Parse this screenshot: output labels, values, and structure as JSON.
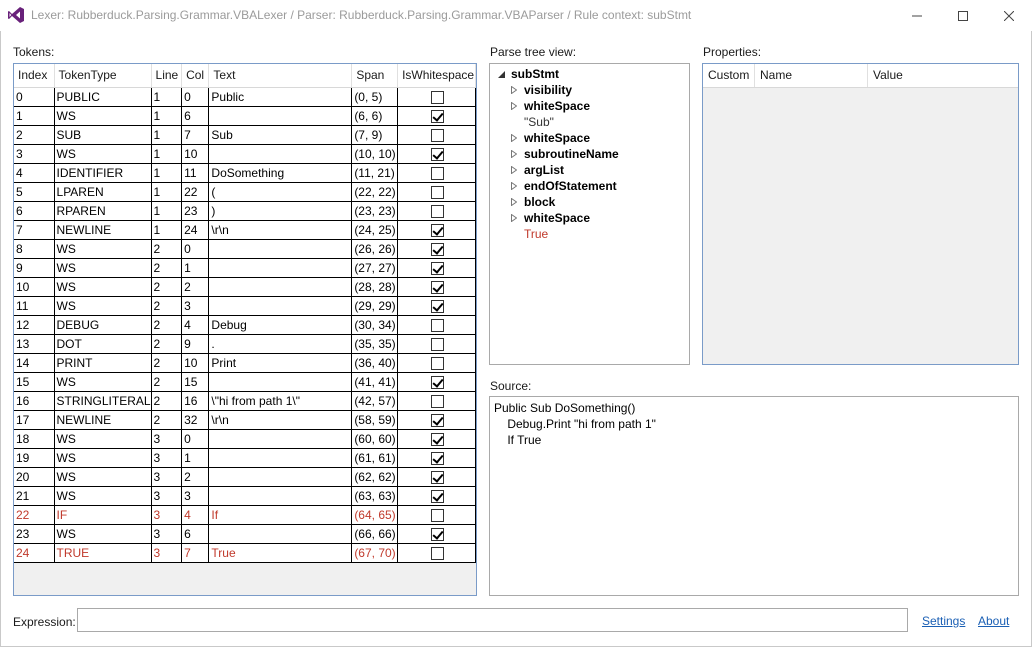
{
  "window": {
    "title": "Lexer: Rubberduck.Parsing.Grammar.VBALexer  /   Parser: Rubberduck.Parsing.Grammar.VBAParser  /   Rule context: subStmt",
    "min_glyph": "—",
    "max_glyph": "☐",
    "close_glyph": "✕"
  },
  "tokens": {
    "label": "Tokens:",
    "columns": [
      "Index",
      "TokenType",
      "Line",
      "Col",
      "Text",
      "Span",
      "IsWhitespace"
    ],
    "rows": [
      {
        "index": "0",
        "type": "PUBLIC",
        "line": "1",
        "col": "0",
        "text": "Public",
        "span": "(0, 5)",
        "ws": false,
        "hl": false
      },
      {
        "index": "1",
        "type": "WS",
        "line": "1",
        "col": "6",
        "text": "",
        "span": "(6, 6)",
        "ws": true,
        "hl": false
      },
      {
        "index": "2",
        "type": "SUB",
        "line": "1",
        "col": "7",
        "text": "Sub",
        "span": "(7, 9)",
        "ws": false,
        "hl": false
      },
      {
        "index": "3",
        "type": "WS",
        "line": "1",
        "col": "10",
        "text": "",
        "span": "(10, 10)",
        "ws": true,
        "hl": false
      },
      {
        "index": "4",
        "type": "IDENTIFIER",
        "line": "1",
        "col": "11",
        "text": "DoSomething",
        "span": "(11, 21)",
        "ws": false,
        "hl": false
      },
      {
        "index": "5",
        "type": "LPAREN",
        "line": "1",
        "col": "22",
        "text": "(",
        "span": "(22, 22)",
        "ws": false,
        "hl": false
      },
      {
        "index": "6",
        "type": "RPAREN",
        "line": "1",
        "col": "23",
        "text": ")",
        "span": "(23, 23)",
        "ws": false,
        "hl": false
      },
      {
        "index": "7",
        "type": "NEWLINE",
        "line": "1",
        "col": "24",
        "text": "\\r\\n",
        "span": "(24, 25)",
        "ws": true,
        "hl": false
      },
      {
        "index": "8",
        "type": "WS",
        "line": "2",
        "col": "0",
        "text": "",
        "span": "(26, 26)",
        "ws": true,
        "hl": false
      },
      {
        "index": "9",
        "type": "WS",
        "line": "2",
        "col": "1",
        "text": "",
        "span": "(27, 27)",
        "ws": true,
        "hl": false
      },
      {
        "index": "10",
        "type": "WS",
        "line": "2",
        "col": "2",
        "text": "",
        "span": "(28, 28)",
        "ws": true,
        "hl": false
      },
      {
        "index": "11",
        "type": "WS",
        "line": "2",
        "col": "3",
        "text": "",
        "span": "(29, 29)",
        "ws": true,
        "hl": false
      },
      {
        "index": "12",
        "type": "DEBUG",
        "line": "2",
        "col": "4",
        "text": "Debug",
        "span": "(30, 34)",
        "ws": false,
        "hl": false
      },
      {
        "index": "13",
        "type": "DOT",
        "line": "2",
        "col": "9",
        "text": ".",
        "span": "(35, 35)",
        "ws": false,
        "hl": false
      },
      {
        "index": "14",
        "type": "PRINT",
        "line": "2",
        "col": "10",
        "text": "Print",
        "span": "(36, 40)",
        "ws": false,
        "hl": false
      },
      {
        "index": "15",
        "type": "WS",
        "line": "2",
        "col": "15",
        "text": "",
        "span": "(41, 41)",
        "ws": true,
        "hl": false
      },
      {
        "index": "16",
        "type": "STRINGLITERAL",
        "line": "2",
        "col": "16",
        "text": "\\\"hi from path 1\\\"",
        "span": "(42, 57)",
        "ws": false,
        "hl": false
      },
      {
        "index": "17",
        "type": "NEWLINE",
        "line": "2",
        "col": "32",
        "text": "\\r\\n",
        "span": "(58, 59)",
        "ws": true,
        "hl": false
      },
      {
        "index": "18",
        "type": "WS",
        "line": "3",
        "col": "0",
        "text": "",
        "span": "(60, 60)",
        "ws": true,
        "hl": false
      },
      {
        "index": "19",
        "type": "WS",
        "line": "3",
        "col": "1",
        "text": "",
        "span": "(61, 61)",
        "ws": true,
        "hl": false
      },
      {
        "index": "20",
        "type": "WS",
        "line": "3",
        "col": "2",
        "text": "",
        "span": "(62, 62)",
        "ws": true,
        "hl": false
      },
      {
        "index": "21",
        "type": "WS",
        "line": "3",
        "col": "3",
        "text": "",
        "span": "(63, 63)",
        "ws": true,
        "hl": false
      },
      {
        "index": "22",
        "type": "IF",
        "line": "3",
        "col": "4",
        "text": "If",
        "span": "(64, 65)",
        "ws": false,
        "hl": true
      },
      {
        "index": "23",
        "type": "WS",
        "line": "3",
        "col": "6",
        "text": "",
        "span": "(66, 66)",
        "ws": true,
        "hl": false
      },
      {
        "index": "24",
        "type": "TRUE",
        "line": "3",
        "col": "7",
        "text": "True",
        "span": "(67, 70)",
        "ws": false,
        "hl": true
      }
    ]
  },
  "parse_tree": {
    "label": "Parse tree view:",
    "root": "subStmt",
    "items": [
      {
        "text": "visibility",
        "kind": "node"
      },
      {
        "text": "whiteSpace",
        "kind": "node"
      },
      {
        "text": "\"Sub\"",
        "kind": "value"
      },
      {
        "text": "whiteSpace",
        "kind": "node"
      },
      {
        "text": "subroutineName",
        "kind": "node"
      },
      {
        "text": "argList",
        "kind": "node"
      },
      {
        "text": "endOfStatement",
        "kind": "node"
      },
      {
        "text": "block",
        "kind": "node"
      },
      {
        "text": "whiteSpace",
        "kind": "node"
      },
      {
        "text": "True",
        "kind": "error"
      }
    ]
  },
  "properties": {
    "label": "Properties:",
    "columns": [
      "Custom",
      "Name",
      "Value"
    ]
  },
  "source": {
    "label": "Source:",
    "lines": [
      "Public Sub DoSomething()",
      "    Debug.Print \"hi from path 1\"",
      "    If True"
    ]
  },
  "footer": {
    "expression_label": "Expression:",
    "expression_value": "",
    "settings_link": "Settings",
    "about_link": "About"
  },
  "colors": {
    "highlight_text": "#c0392b",
    "grid_border": "#7a9bc8",
    "link": "#1a5fb4"
  }
}
